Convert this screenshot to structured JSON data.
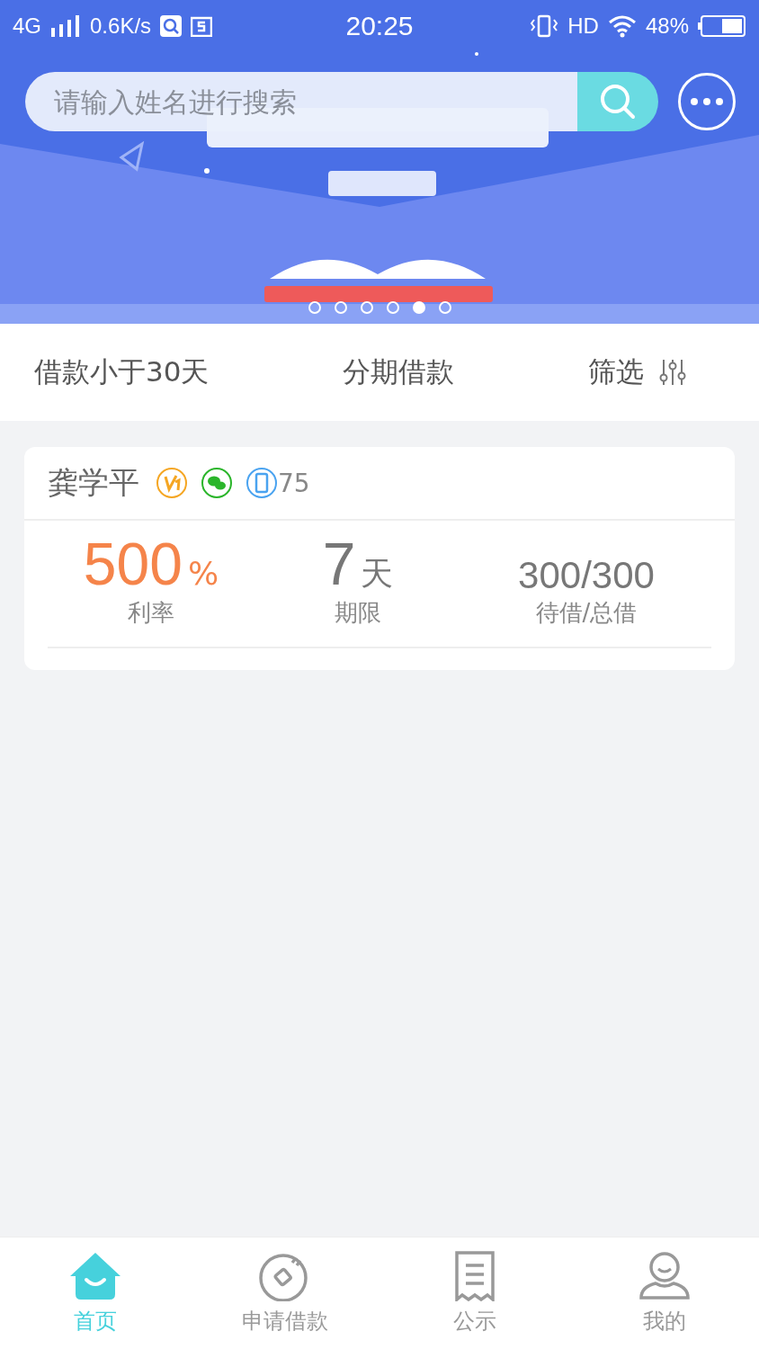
{
  "status_bar": {
    "network": "4G",
    "speed": "0.6K/s",
    "time": "20:25",
    "hd": "HD",
    "battery": "48%"
  },
  "search": {
    "placeholder": "请输入姓名进行搜索"
  },
  "banner": {
    "kind": "picture",
    "dots": [
      {
        "selected": false
      },
      {
        "selected": false
      },
      {
        "selected": false
      },
      {
        "selected": false
      },
      {
        "selected": true
      },
      {
        "selected": false
      }
    ]
  },
  "filters": [
    {
      "label": "借款小于30天",
      "kind": "tab"
    },
    {
      "label": "分期借款",
      "kind": "tab"
    },
    {
      "label": "筛选",
      "kind": "filter"
    }
  ],
  "loans": [
    {
      "name": "龚学平",
      "badges": [
        {
          "kind": "vip",
          "color": "#f5a623"
        },
        {
          "kind": "wechat",
          "color": "#2bb52b"
        },
        {
          "kind": "phone",
          "color": "#4aa3f0"
        }
      ],
      "score": "75",
      "rate": "500",
      "rate_unit": "%",
      "rate_label": "利率",
      "term": "7",
      "term_unit": "天",
      "term_label": "期限",
      "amount": "300/300",
      "amount_label": "待借/总借"
    }
  ],
  "nav": [
    {
      "label": "首页",
      "kind": "home",
      "selected": true
    },
    {
      "label": "申请借款",
      "kind": "apply",
      "selected": false
    },
    {
      "label": "公示",
      "kind": "notice",
      "selected": false
    },
    {
      "label": "我的",
      "kind": "profile",
      "selected": false
    }
  ]
}
